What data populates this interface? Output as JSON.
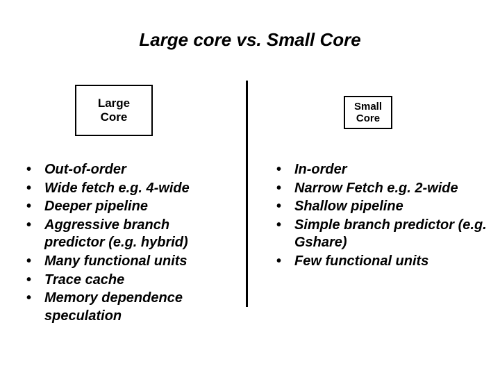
{
  "title": "Large core vs. Small Core",
  "large_box": "Large\nCore",
  "small_box": "Small\nCore",
  "left": {
    "items": [
      "Out-of-order",
      "Wide fetch e.g. 4-wide",
      "Deeper pipeline",
      "Aggressive branch predictor (e.g. hybrid)",
      "Many functional units",
      "Trace cache",
      "Memory dependence speculation"
    ]
  },
  "right": {
    "items": [
      "In-order",
      "Narrow Fetch e.g. 2-wide",
      "Shallow pipeline",
      "Simple branch predictor (e.g. Gshare)",
      "Few functional units"
    ]
  }
}
